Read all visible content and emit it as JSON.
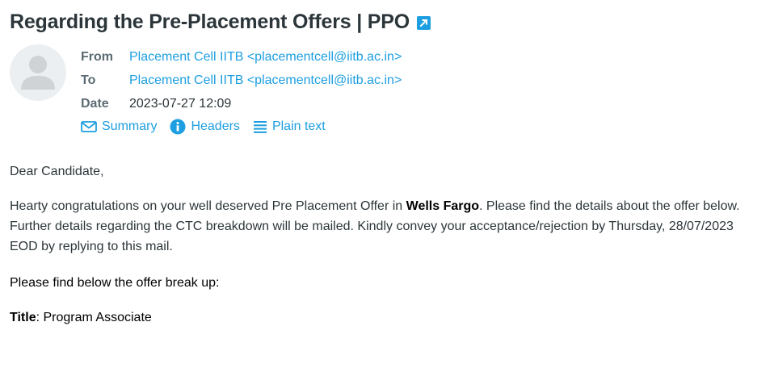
{
  "email": {
    "subject": "Regarding the Pre-Placement Offers | PPO",
    "headers": {
      "from_label": "From",
      "from_value": "Placement Cell IITB <placementcell@iitb.ac.in>",
      "to_label": "To",
      "to_value": "Placement Cell IITB <placementcell@iitb.ac.in>",
      "date_label": "Date",
      "date_value": "2023-07-27 12:09"
    },
    "toolbar": {
      "summary": "Summary",
      "headers": "Headers",
      "plain_text": "Plain text"
    },
    "body": {
      "greeting": "Dear Candidate,",
      "para1_prefix": "Hearty congratulations on your well deserved Pre Placement Offer in ",
      "para1_company": "Wells Fargo",
      "para1_suffix": ". Please find the details about the offer below. Further details regarding the CTC breakdown will be mailed. Kindly convey your acceptance/rejection by Thursday, 28/07/2023 EOD by replying to this mail.",
      "breakup_intro": "Please find below the offer break up:",
      "title_label": "Title",
      "title_value": ": Program Associate"
    }
  },
  "colors": {
    "accent": "#1d9ee0",
    "text": "#2c363a",
    "label": "#5c6b73",
    "avatar_bg": "#eceff1"
  },
  "icons": {
    "open_external": "external-link-icon",
    "avatar": "user-avatar-icon",
    "summary": "envelope-icon",
    "headers": "info-icon",
    "plain_text": "lines-icon"
  }
}
